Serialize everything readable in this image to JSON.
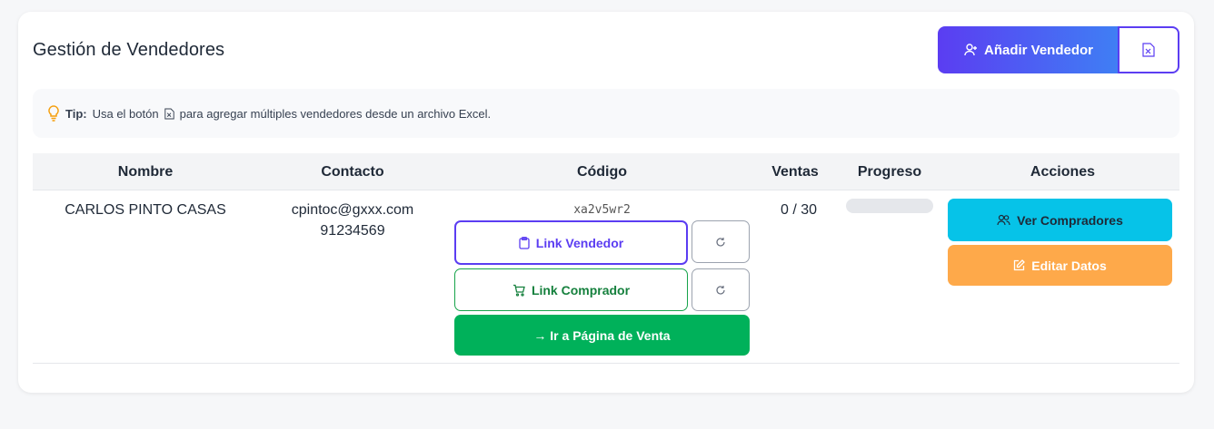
{
  "header": {
    "title": "Gestión de Vendedores",
    "add_button_label": "Añadir Vendedor"
  },
  "tip": {
    "label": "Tip:",
    "text_before": "Usa el botón",
    "text_after": "para agregar múltiples vendedores desde un archivo Excel."
  },
  "table": {
    "columns": [
      "Nombre",
      "Contacto",
      "Código",
      "Ventas",
      "Progreso",
      "Acciones"
    ],
    "rows": [
      {
        "nombre": "CARLOS PINTO CASAS",
        "email": "cpintoc@gxxx.com",
        "phone": "91234569",
        "codigo": "xa2v5wr2",
        "link_vendedor_label": "Link Vendedor",
        "link_comprador_label": "Link Comprador",
        "venta_label": "→ Ir a Página de Venta",
        "ventas": "0 / 30",
        "progress_fraction": 0,
        "ver_label": "Ver Compradores",
        "editar_label": "Editar Datos"
      }
    ]
  },
  "colors": {
    "primary": "#5b3df2",
    "green": "#00b15a",
    "cyan": "#06c3e8",
    "orange": "#fea94a"
  },
  "icons": [
    "user-plus-icon",
    "excel-file-icon",
    "lightbulb-icon",
    "clipboard-icon",
    "refresh-icon",
    "cart-icon",
    "users-icon",
    "edit-icon"
  ]
}
